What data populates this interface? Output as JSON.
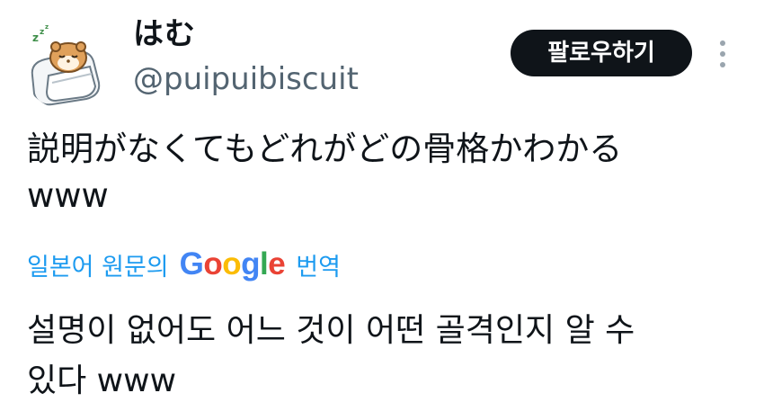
{
  "author": {
    "display_name": "はむ",
    "handle": "@puipuibiscuit",
    "avatar_icon": "sleeping-hamster-avatar"
  },
  "actions": {
    "follow_label": "팔로우하기",
    "more_icon": "more-vertical-icon"
  },
  "tweet": {
    "text_line1": "説明がなくてもどれがどの骨格かわかる",
    "text_line2": "www"
  },
  "translation": {
    "label_prefix": "일본어 원문의",
    "provider_logo": [
      {
        "char": "G",
        "color": "#4285F4"
      },
      {
        "char": "o",
        "color": "#EA4335"
      },
      {
        "char": "o",
        "color": "#FBBC05"
      },
      {
        "char": "g",
        "color": "#4285F4"
      },
      {
        "char": "l",
        "color": "#34A853"
      },
      {
        "char": "e",
        "color": "#EA4335"
      }
    ],
    "label_suffix": "번역",
    "text_line1": "설명이 없어도 어느 것이 어떤 골격인지 알 수",
    "text_line2": "있다 www"
  },
  "colors": {
    "link": "#1d9bf0",
    "secondary": "#536471",
    "button_bg": "#0f1419"
  }
}
